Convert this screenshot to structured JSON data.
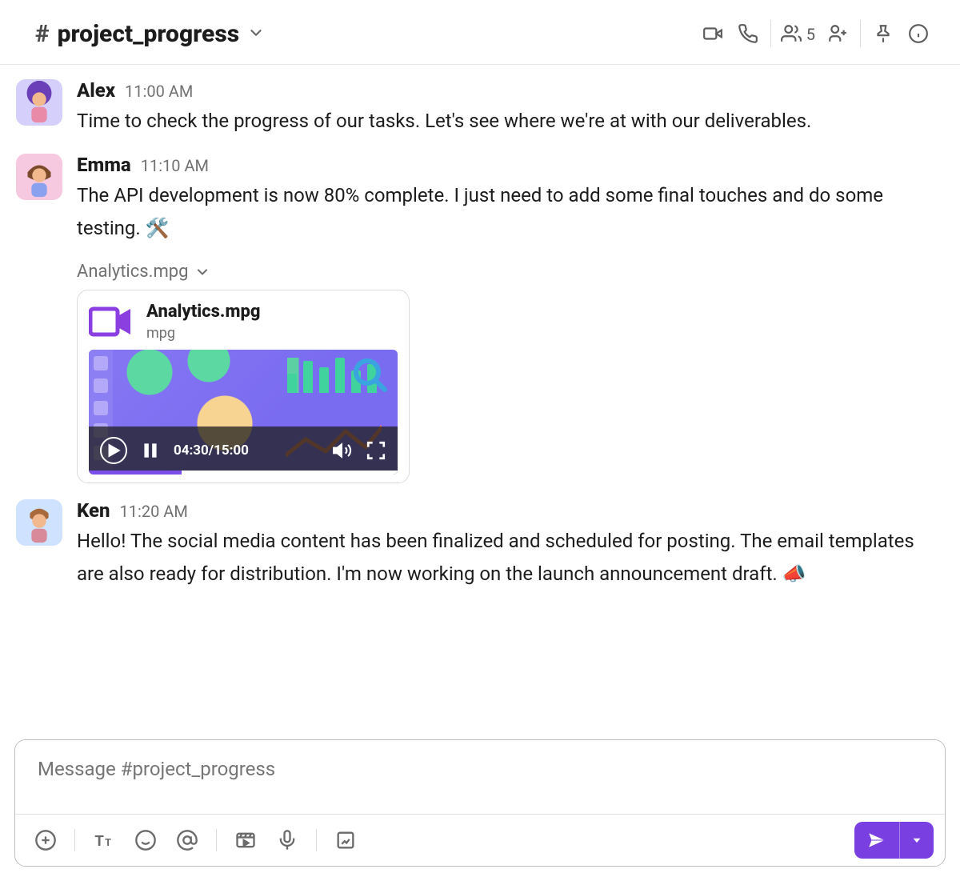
{
  "channel": {
    "name": "project_progress",
    "members_count": "5"
  },
  "messages": [
    {
      "user": "Alex",
      "time": "11:00 AM",
      "text": "Time to check the progress of our tasks. Let's see where we're at with our deliverables.",
      "avatar_bg": "#d4cffb"
    },
    {
      "user": "Emma",
      "time": "11:10 AM",
      "text": "The API development is now 80% complete. I just need to add some final touches and do some testing. 🛠️",
      "avatar_bg": "#f7c9e1",
      "attachment": {
        "label": "Analytics.mpg",
        "name": "Analytics.mpg",
        "ext": "mpg",
        "playback": "04:30/15:00"
      }
    },
    {
      "user": "Ken",
      "time": "11:20 AM",
      "text": "Hello! The social media content has been finalized and scheduled for posting. The email templates are also ready for distribution. I'm now working on the launch announcement draft. 📣",
      "avatar_bg": "#cfe2ff"
    }
  ],
  "composer": {
    "placeholder": "Message #project_progress"
  }
}
